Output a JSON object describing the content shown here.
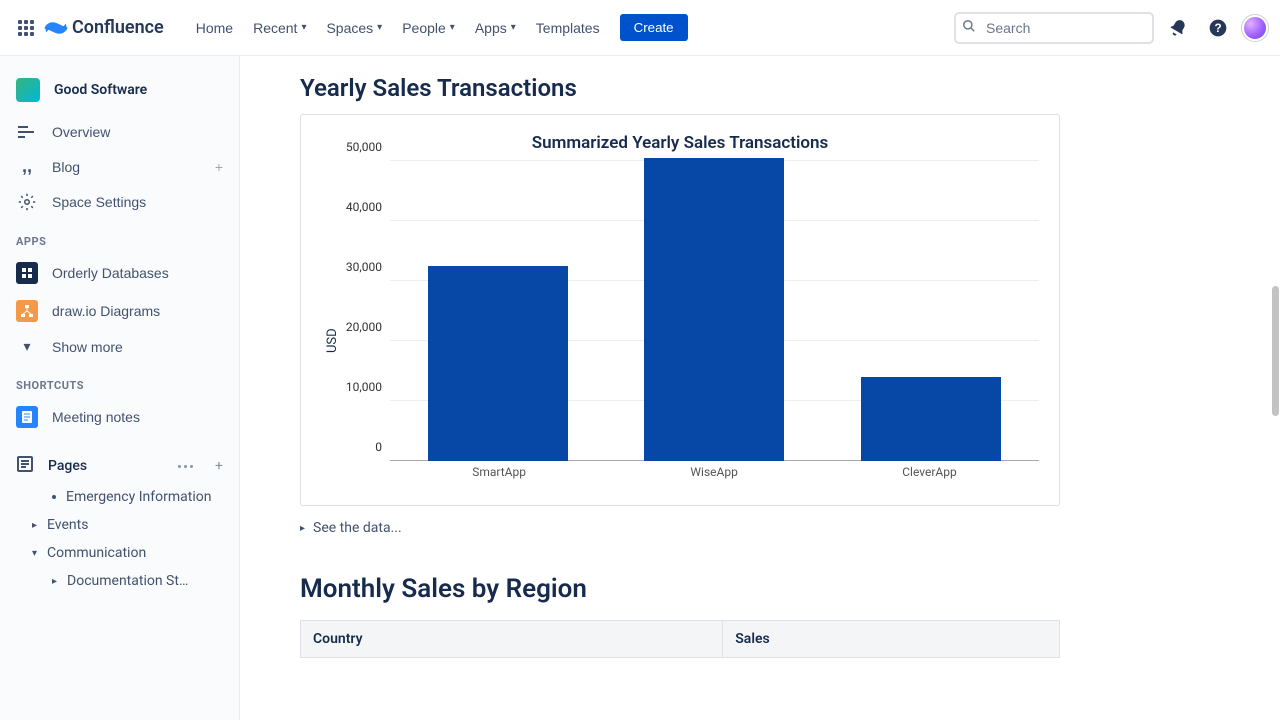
{
  "nav": {
    "product": "Confluence",
    "home": "Home",
    "recent": "Recent",
    "spaces": "Spaces",
    "people": "People",
    "apps": "Apps",
    "templates": "Templates",
    "create": "Create",
    "search_placeholder": "Search"
  },
  "sidebar": {
    "space_name": "Good Software",
    "overview": "Overview",
    "blog": "Blog",
    "space_settings": "Space Settings",
    "section_apps": "APPS",
    "orderly": "Orderly Databases",
    "drawio": "draw.io Diagrams",
    "show_more": "Show more",
    "section_shortcuts": "SHORTCUTS",
    "meeting_notes": "Meeting notes",
    "pages": "Pages",
    "emergency": "Emergency Information",
    "events": "Events",
    "communication": "Communication",
    "doc_st": "Documentation St…"
  },
  "content": {
    "heading_yearly": "Yearly Sales Transactions",
    "chart_title": "Summarized Yearly Sales Transactions",
    "see_data": "See the data...",
    "heading_monthly": "Monthly Sales by Region",
    "th_country": "Country",
    "th_sales": "Sales",
    "ylabel": "USD",
    "yticks": {
      "t0": "0",
      "t1": "10,000",
      "t2": "20,000",
      "t3": "30,000",
      "t4": "40,000",
      "t5": "50,000"
    },
    "cats": {
      "c0": "SmartApp",
      "c1": "WiseApp",
      "c2": "CleverApp"
    }
  },
  "chart_data": {
    "type": "bar",
    "title": "Summarized Yearly Sales Transactions",
    "ylabel": "USD",
    "ylim": [
      0,
      50000
    ],
    "categories": [
      "SmartApp",
      "WiseApp",
      "CleverApp"
    ],
    "values": [
      32500,
      50500,
      14000
    ],
    "colors": {
      "bar": "#0747A6"
    }
  }
}
